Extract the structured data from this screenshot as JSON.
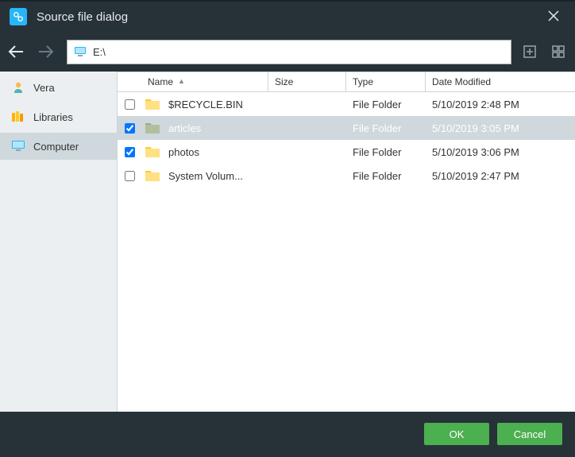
{
  "title": "Source file dialog",
  "path": "E:\\",
  "sidebar": {
    "items": [
      {
        "label": "Vera",
        "icon": "user-icon",
        "selected": false
      },
      {
        "label": "Libraries",
        "icon": "libraries-icon",
        "selected": false
      },
      {
        "label": "Computer",
        "icon": "computer-icon",
        "selected": true
      }
    ]
  },
  "columns": {
    "name": "Name",
    "size": "Size",
    "type": "Type",
    "date": "Date Modified"
  },
  "rows": [
    {
      "name": "$RECYCLE.BIN",
      "size": "",
      "type": "File Folder",
      "date": "5/10/2019 2:48 PM",
      "checked": false,
      "selected": false
    },
    {
      "name": "articles",
      "size": "",
      "type": "File Folder",
      "date": "5/10/2019 3:05 PM",
      "checked": true,
      "selected": true
    },
    {
      "name": "photos",
      "size": "",
      "type": "File Folder",
      "date": "5/10/2019 3:06 PM",
      "checked": true,
      "selected": false
    },
    {
      "name": "System Volum...",
      "size": "",
      "type": "File Folder",
      "date": "5/10/2019 2:47 PM",
      "checked": false,
      "selected": false
    }
  ],
  "buttons": {
    "ok": "OK",
    "cancel": "Cancel"
  }
}
